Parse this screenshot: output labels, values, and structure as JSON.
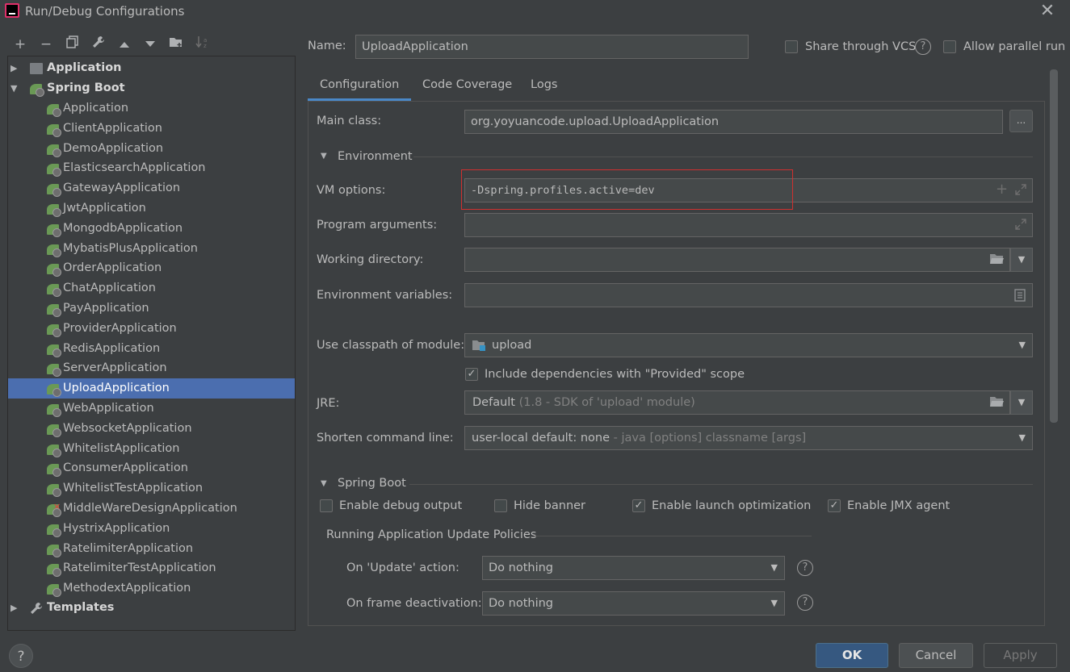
{
  "window": {
    "title": "Run/Debug Configurations"
  },
  "toolbar": {
    "icons": [
      "add-icon",
      "remove-icon",
      "copy-icon",
      "wrench-icon",
      "move-up-icon",
      "move-down-icon",
      "new-folder-icon",
      "sort-icon"
    ]
  },
  "tree": {
    "application_label": "Application",
    "spring_boot_label": "Spring Boot",
    "spring_items": [
      "Application",
      "ClientApplication",
      "DemoApplication",
      "ElasticsearchApplication",
      "GatewayApplication",
      "JwtApplication",
      "MongodbApplication",
      "MybatisPlusApplication",
      "OrderApplication",
      "ChatApplication",
      "PayApplication",
      "ProviderApplication",
      "RedisApplication",
      "ServerApplication",
      "UploadApplication",
      "WebApplication",
      "WebsocketApplication",
      "WhitelistApplication",
      "ConsumerApplication",
      "WhitelistTestApplication",
      "MiddleWareDesignApplication",
      "HystrixApplication",
      "RatelimiterApplication",
      "RatelimiterTestApplication",
      "MethodextApplication"
    ],
    "selected": "UploadApplication",
    "error_item": "MiddleWareDesignApplication",
    "templates_label": "Templates"
  },
  "header": {
    "name_label": "Name:",
    "name_value": "UploadApplication",
    "share_vcs_label": "Share through VCS",
    "allow_parallel_label": "Allow parallel run",
    "help_glyph": "?"
  },
  "tabs": [
    "Configuration",
    "Code Coverage",
    "Logs"
  ],
  "config": {
    "main_class_label": "Main class:",
    "main_class_value": "org.yoyuancode.upload.UploadApplication",
    "browse_label": "...",
    "environment_section": "Environment",
    "vm_options_label": "VM options:",
    "vm_options_value": "-Dspring.profiles.active=dev",
    "program_args_label": "Program arguments:",
    "working_dir_label": "Working directory:",
    "env_vars_label": "Environment variables:",
    "classpath_label": "Use classpath of module:",
    "classpath_value": "upload",
    "include_deps_label": "Include dependencies with \"Provided\" scope",
    "include_deps_checked": true,
    "jre_label": "JRE:",
    "jre_value": "Default",
    "jre_hint": "(1.8 - SDK of 'upload' module)",
    "shorten_label": "Shorten command line:",
    "shorten_value": "user-local default: none",
    "shorten_hint": "- java [options] classname [args]"
  },
  "spring_boot": {
    "section": "Spring Boot",
    "debug_output_label": "Enable debug output",
    "debug_output_checked": false,
    "hide_banner_label": "Hide banner",
    "hide_banner_checked": false,
    "launch_opt_label": "Enable launch optimization",
    "launch_opt_checked": true,
    "jmx_label": "Enable JMX agent",
    "jmx_checked": true,
    "update_policies_section": "Running Application Update Policies",
    "on_update_label": "On 'Update' action:",
    "on_update_value": "Do nothing",
    "on_frame_label": "On frame deactivation:",
    "on_frame_value": "Do nothing"
  },
  "footer": {
    "ok": "OK",
    "cancel": "Cancel",
    "apply": "Apply",
    "help": "?"
  },
  "colors": {
    "accent": "#4b6eaf",
    "highlight_box": "#d0302f",
    "background": "#3c3f41"
  }
}
